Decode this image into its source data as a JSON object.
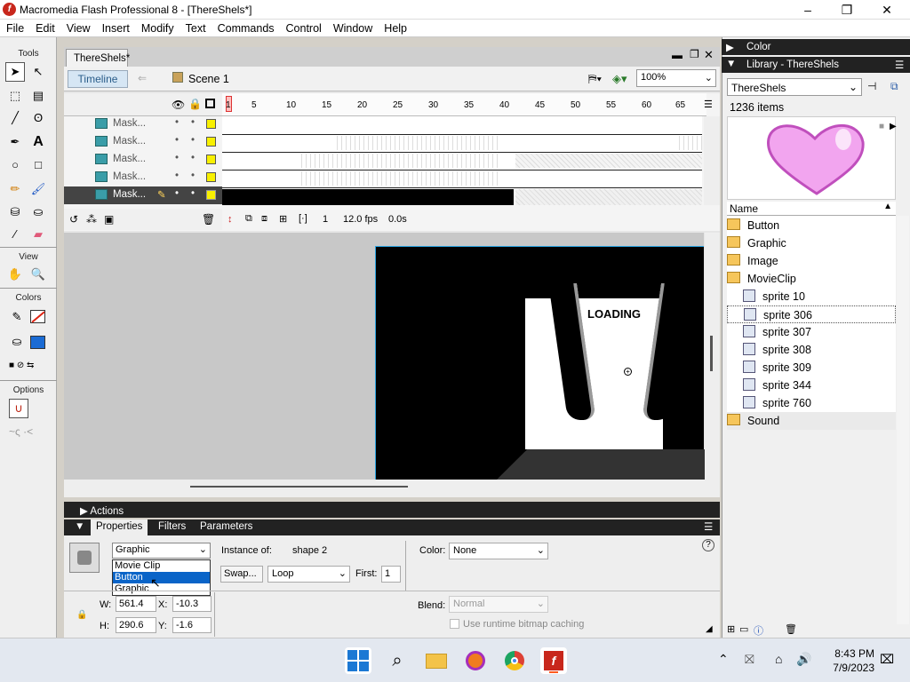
{
  "window": {
    "title": "Macromedia Flash Professional 8 - [ThereShels*]",
    "minimize": "–",
    "maximize": "❐",
    "close": "✕"
  },
  "menu": [
    "File",
    "Edit",
    "View",
    "Insert",
    "Modify",
    "Text",
    "Commands",
    "Control",
    "Window",
    "Help"
  ],
  "tools": {
    "header": "Tools",
    "view": "View",
    "colors": "Colors",
    "options": "Options"
  },
  "doc": {
    "tab": "ThereShels*",
    "timeline_btn": "Timeline",
    "scene": "Scene 1",
    "zoom": "100%"
  },
  "timeline": {
    "ruler": [
      "1",
      "5",
      "10",
      "15",
      "20",
      "25",
      "30",
      "35",
      "40",
      "45",
      "50",
      "55",
      "60",
      "65"
    ],
    "layers": [
      "Mask...",
      "Mask...",
      "Mask...",
      "Mask...",
      "Mask..."
    ],
    "frame": "1",
    "fps": "12.0 fps",
    "time": "0.0s"
  },
  "stage": {
    "loading": "LOADING"
  },
  "panels": {
    "actions": "Actions",
    "tabs": [
      "Properties",
      "Filters",
      "Parameters"
    ]
  },
  "props": {
    "type_select": "Graphic",
    "type_options": [
      "Movie Clip",
      "Button",
      "Graphic"
    ],
    "highlighted_option": "Button",
    "instance_of_label": "Instance of:",
    "instance_of_value": "shape 2",
    "swap": "Swap...",
    "loop": "Loop",
    "first_label": "First:",
    "first_value": "1",
    "color_label": "Color:",
    "color_value": "None",
    "blend_label": "Blend:",
    "blend_value": "Normal",
    "cache_label": "Use runtime bitmap caching",
    "w_label": "W:",
    "w": "561.4",
    "h_label": "H:",
    "h": "290.6",
    "x_label": "X:",
    "x": "-10.3",
    "y_label": "Y:",
    "y": "-1.6"
  },
  "right": {
    "color_header": "Color",
    "library_header": "Library - ThereShels",
    "library_select": "ThereShels",
    "item_count": "1236 items",
    "name_col": "Name",
    "items": [
      {
        "label": "Button",
        "kind": "folder"
      },
      {
        "label": "Graphic",
        "kind": "folder"
      },
      {
        "label": "Image",
        "kind": "folder"
      },
      {
        "label": "MovieClip",
        "kind": "folder-open"
      },
      {
        "label": "sprite 10",
        "kind": "sprite"
      },
      {
        "label": "sprite 306",
        "kind": "sprite"
      },
      {
        "label": "sprite 307",
        "kind": "sprite"
      },
      {
        "label": "sprite 308",
        "kind": "sprite"
      },
      {
        "label": "sprite 309",
        "kind": "sprite"
      },
      {
        "label": "sprite 344",
        "kind": "sprite"
      },
      {
        "label": "sprite 760",
        "kind": "sprite"
      },
      {
        "label": "Sound",
        "kind": "folder"
      }
    ]
  },
  "taskbar": {
    "time": "8:43 PM",
    "date": "7/9/2023"
  }
}
